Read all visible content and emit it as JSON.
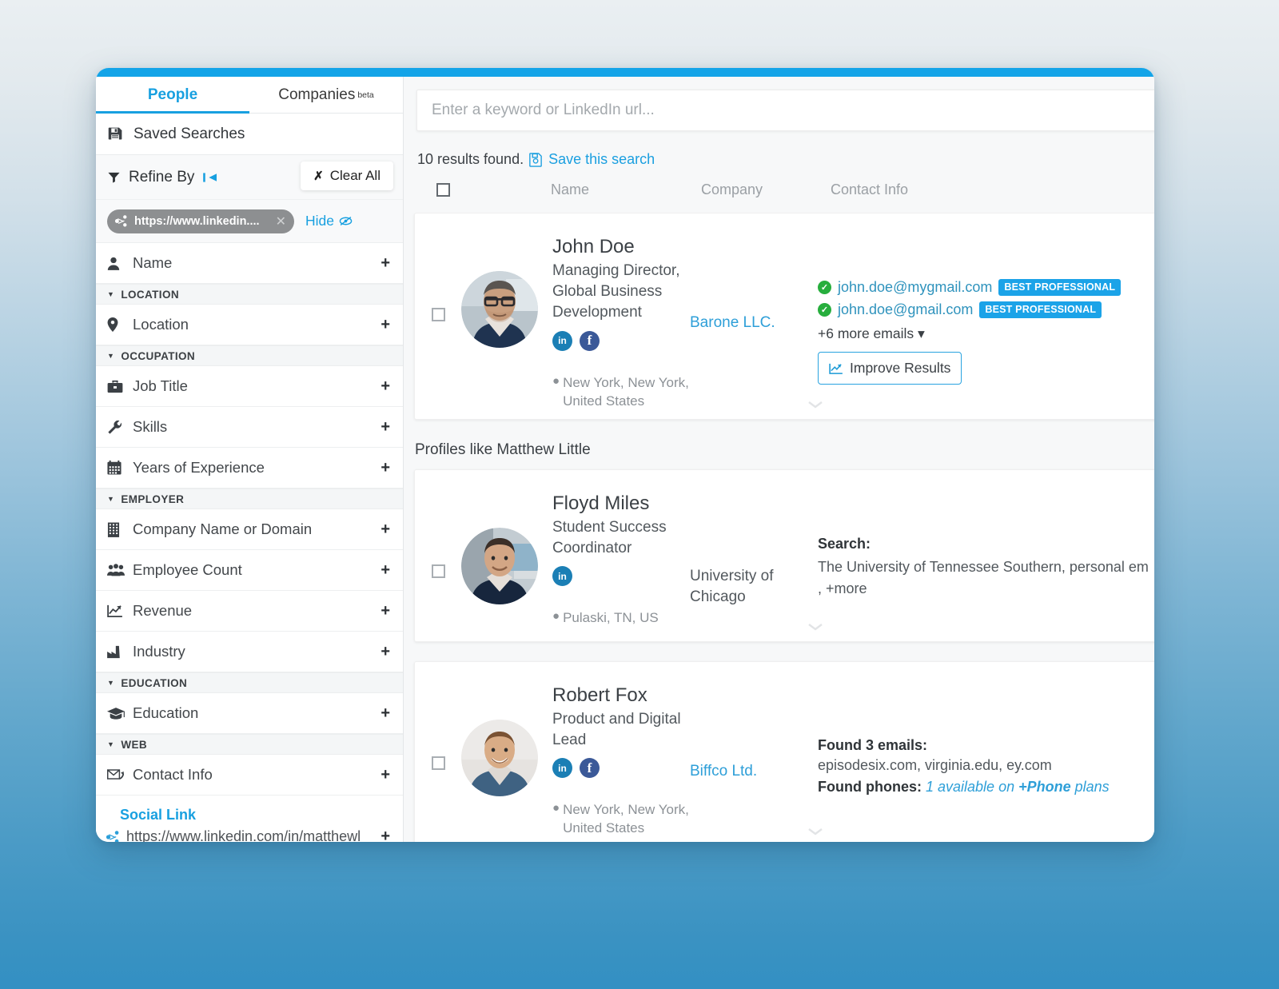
{
  "tabs": [
    {
      "label": "People",
      "active": true
    },
    {
      "label": "Companies",
      "badge": "beta",
      "active": false
    }
  ],
  "sidebar": {
    "saved_searches": "Saved Searches",
    "refine_by": "Refine By",
    "clear_all": "Clear All",
    "chip": {
      "text": "https://www.linkedin....",
      "close": "✕"
    },
    "hide": "Hide",
    "filters": [
      {
        "type": "item",
        "icon": "person-icon",
        "label": "Name",
        "plus": "+"
      },
      {
        "type": "group",
        "label": "LOCATION"
      },
      {
        "type": "item",
        "icon": "map-pin-icon",
        "label": "Location",
        "plus": "+"
      },
      {
        "type": "group",
        "label": "OCCUPATION"
      },
      {
        "type": "item",
        "icon": "briefcase-icon",
        "label": "Job Title",
        "plus": "+"
      },
      {
        "type": "item",
        "icon": "wrench-icon",
        "label": "Skills",
        "plus": "+"
      },
      {
        "type": "item",
        "icon": "calendar-icon",
        "label": "Years of Experience",
        "plus": "+"
      },
      {
        "type": "group",
        "label": "EMPLOYER"
      },
      {
        "type": "item",
        "icon": "building-icon",
        "label": "Company Name or Domain",
        "plus": "+"
      },
      {
        "type": "item",
        "icon": "people-icon",
        "label": "Employee Count",
        "plus": "+"
      },
      {
        "type": "item",
        "icon": "chart-line-icon",
        "label": "Revenue",
        "plus": "+"
      },
      {
        "type": "item",
        "icon": "factory-icon",
        "label": "Industry",
        "plus": "+"
      },
      {
        "type": "group",
        "label": "EDUCATION"
      },
      {
        "type": "item",
        "icon": "graduation-cap-icon",
        "label": "Education",
        "plus": "+"
      },
      {
        "type": "group",
        "label": "WEB"
      },
      {
        "type": "item",
        "icon": "envelope-icon",
        "label": "Contact Info",
        "plus": "+"
      }
    ],
    "social_link": {
      "title": "Social Link",
      "url": "https://www.linkedin.com/in/matthewl",
      "plus": "+"
    }
  },
  "main": {
    "search": {
      "placeholder": "Enter a keyword or LinkedIn url...",
      "value": ""
    },
    "results_found": "10 results found.",
    "save_this_search": "Save this search",
    "columns": {
      "name": "Name",
      "company": "Company",
      "contact": "Contact Info"
    },
    "section_label": "Profiles like Matthew Little",
    "results": [
      {
        "name": "John Doe",
        "title": "Managing Director, Global Business Development",
        "socials": [
          "linkedin",
          "facebook"
        ],
        "location": "New York, New York, United States",
        "company": "Barone LLC.",
        "company_is_link": true,
        "contact_kind": "emails",
        "emails": [
          {
            "address": "john.doe@mygmail.com",
            "badge": "BEST PROFESSIONAL",
            "verified": true
          },
          {
            "address": "john.doe@gmail.com",
            "badge": "BEST PROFESSIONAL",
            "verified": true
          }
        ],
        "more_emails": "+6 more emails",
        "improve_results": "Improve Results",
        "chevron": "⌄"
      },
      {
        "name": "Floyd Miles",
        "title": "Student Success Coordinator",
        "socials": [
          "linkedin"
        ],
        "location": "Pulaski, TN, US",
        "company": "University of Chicago",
        "company_is_link": false,
        "contact_kind": "search",
        "search_label": "Search:",
        "search_value": "The University of Tennessee Southern, personal em",
        "search_more": ",  +more",
        "chevron": "⌄"
      },
      {
        "name": "Robert Fox",
        "title": "Product and Digital Lead",
        "socials": [
          "linkedin",
          "facebook"
        ],
        "location": "New York, New York, United States",
        "company": "Biffco Ltd.",
        "company_is_link": true,
        "contact_kind": "found",
        "found_label": "Found 3 emails:",
        "found_value": "episodesix.com, virginia.edu, ey.com",
        "phones_label": "Found phones:",
        "phones_value_pre": "1 available on ",
        "phones_value_bold": "+Phone",
        "phones_value_post": " plans",
        "chevron": "⌄"
      }
    ]
  },
  "colors": {
    "accent": "#18a0e0",
    "topbar": "#13a4e8",
    "badge": "#1ba3e8",
    "verified": "#27ae3d",
    "email_text": "#2f93bd",
    "company_link": "#2e9fd8",
    "chip_bg": "#8d8f91"
  }
}
